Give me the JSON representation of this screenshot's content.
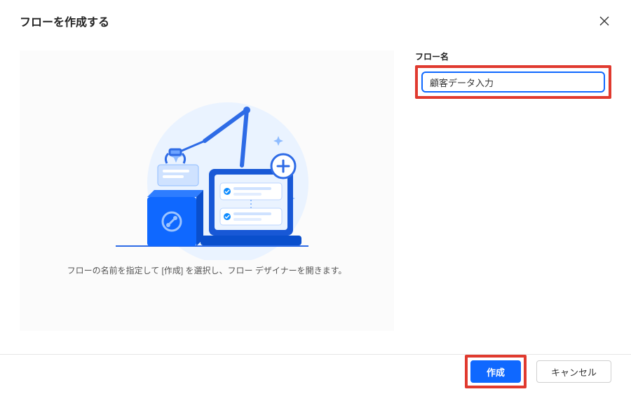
{
  "dialog": {
    "title": "フローを作成する",
    "caption": "フローの名前を指定して [作成] を選択し、フロー デザイナーを開きます。"
  },
  "form": {
    "flow_name_label": "フロー名",
    "flow_name_value": "顧客データ入力"
  },
  "buttons": {
    "create": "作成",
    "cancel": "キャンセル"
  }
}
